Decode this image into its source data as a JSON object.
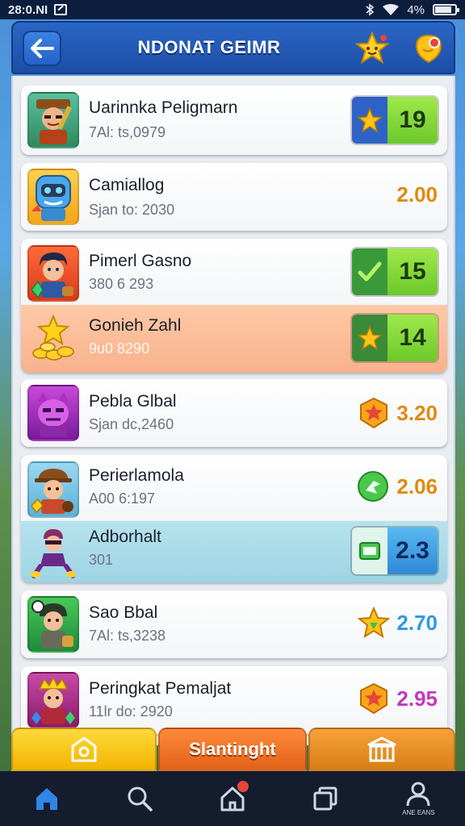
{
  "status": {
    "time": "28:0.NI",
    "battery": "4%"
  },
  "header": {
    "title": "NDONAT GEIMR"
  },
  "rows": [
    {
      "name": "Uarinnka Peligmarn",
      "sub": "7Al: ts,0979",
      "score": "19",
      "score_style": "box-green-star"
    },
    {
      "name": "Camiallog",
      "sub": "Sjan to: 2030",
      "score": "2.00",
      "score_style": "plain-orange"
    },
    {
      "name": "Pimerl Gasno",
      "sub": "380 6 293",
      "score": "15",
      "score_style": "box-green-check"
    },
    {
      "name": "Gonieh Zahl",
      "sub": "9u0 8290",
      "score": "14",
      "score_style": "box-green-star"
    },
    {
      "name": "Pebla Glbal",
      "sub": "Sjan dc,2460",
      "score": "3.20",
      "score_style": "plain-star-orange"
    },
    {
      "name": "Perierlamola",
      "sub": "A00 6:197",
      "score": "2.06",
      "score_style": "plain-green-orange"
    },
    {
      "name": "Adborhalt",
      "sub": "301",
      "score": "2.3",
      "score_style": "box-blue"
    },
    {
      "name": "Sao Bbal",
      "sub": "7Al: ts,3238",
      "score": "2.70",
      "score_style": "plain-star-blue"
    },
    {
      "name": "Peringkat Pemaljat",
      "sub": "11lr do: 2920",
      "score": "2.95",
      "score_style": "plain-star-purple"
    }
  ],
  "actions": {
    "middle_label": "Slantinght"
  },
  "nav": {
    "profile_caption": "ANE EANS"
  },
  "colors": {
    "header_blue": "#1c4ea6",
    "score_green": "#7fd63a",
    "score_blue": "#3a9ae0",
    "score_orange": "#e08a10",
    "score_purple": "#c03ac0",
    "nav_active": "#2f86e6"
  },
  "icons": {
    "back": "arrow-left-icon",
    "header_star": "star-face-icon",
    "header_badge": "notification-badge-icon",
    "nav": [
      "home-icon",
      "search-icon",
      "notification-home-icon",
      "windows-icon",
      "profile-icon"
    ]
  }
}
